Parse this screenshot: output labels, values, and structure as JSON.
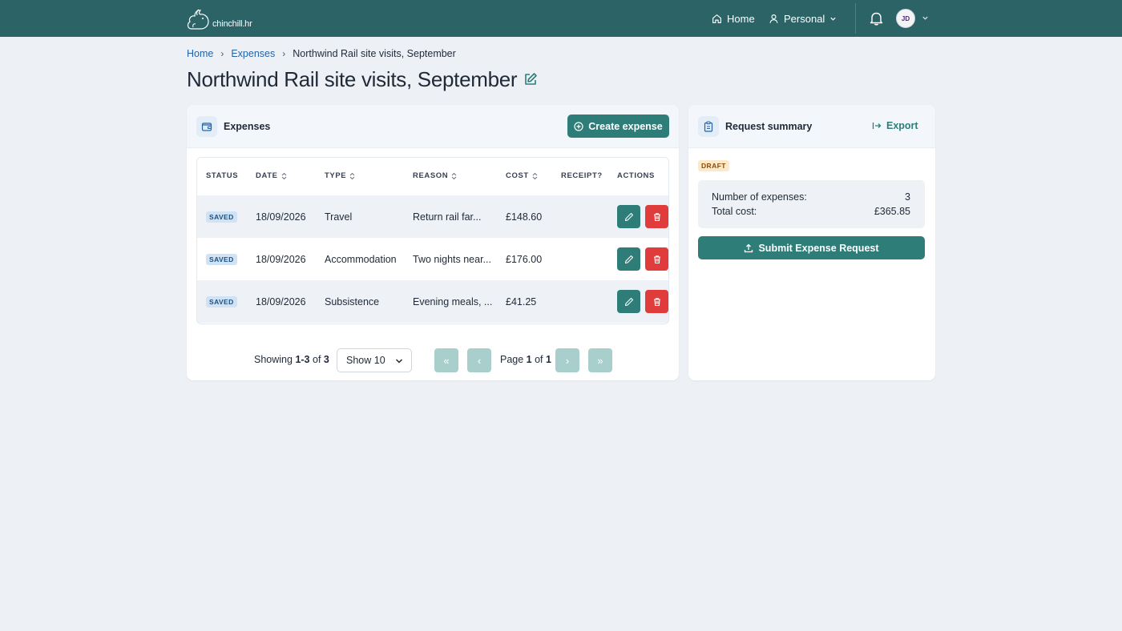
{
  "app": {
    "logo_text": "chinchill.hr"
  },
  "nav": {
    "home_label": "Home",
    "personal_label": "Personal",
    "avatar_initials": "JD"
  },
  "breadcrumb": {
    "home": "Home",
    "expenses": "Expenses",
    "current": "Northwind Rail site visits, September",
    "separator": "›"
  },
  "page": {
    "title": "Northwind Rail site visits, September"
  },
  "expenses_card": {
    "title": "Expenses",
    "create_button": "Create expense",
    "columns": [
      "STATUS",
      "DATE",
      "TYPE",
      "REASON",
      "COST",
      "RECEIPT?",
      "ACTIONS"
    ],
    "rows": [
      {
        "status": "SAVED",
        "date": "18/09/2026",
        "type": "Travel",
        "reason": "Return rail far...",
        "cost": "£148.60",
        "receipt": ""
      },
      {
        "status": "SAVED",
        "date": "18/09/2026",
        "type": "Accommodation",
        "reason": "Two nights near...",
        "cost": "£176.00",
        "receipt": ""
      },
      {
        "status": "SAVED",
        "date": "18/09/2026",
        "type": "Subsistence",
        "reason": "Evening meals, ...",
        "cost": "£41.25",
        "receipt": ""
      }
    ],
    "pagination": {
      "showing_prefix": "Showing ",
      "range": "1-3",
      "of_word": " of ",
      "total": "3",
      "page_size": "Show 10",
      "page_prefix": "Page ",
      "page_current": "1",
      "page_total": "1",
      "first": "«",
      "prev": "‹",
      "next": "›",
      "last": "»"
    }
  },
  "summary_card": {
    "title": "Request summary",
    "export_label": "Export",
    "status_badge": "DRAFT",
    "number_label": "Number of expenses:",
    "number_value": "3",
    "total_label": "Total cost:",
    "total_value": "£365.85",
    "submit_button": "Submit Expense Request"
  },
  "colors": {
    "topbar": "#2c6367",
    "primary": "#2e7d78",
    "danger": "#e03c3c",
    "link": "#2563a6",
    "background": "#edf1f5"
  }
}
